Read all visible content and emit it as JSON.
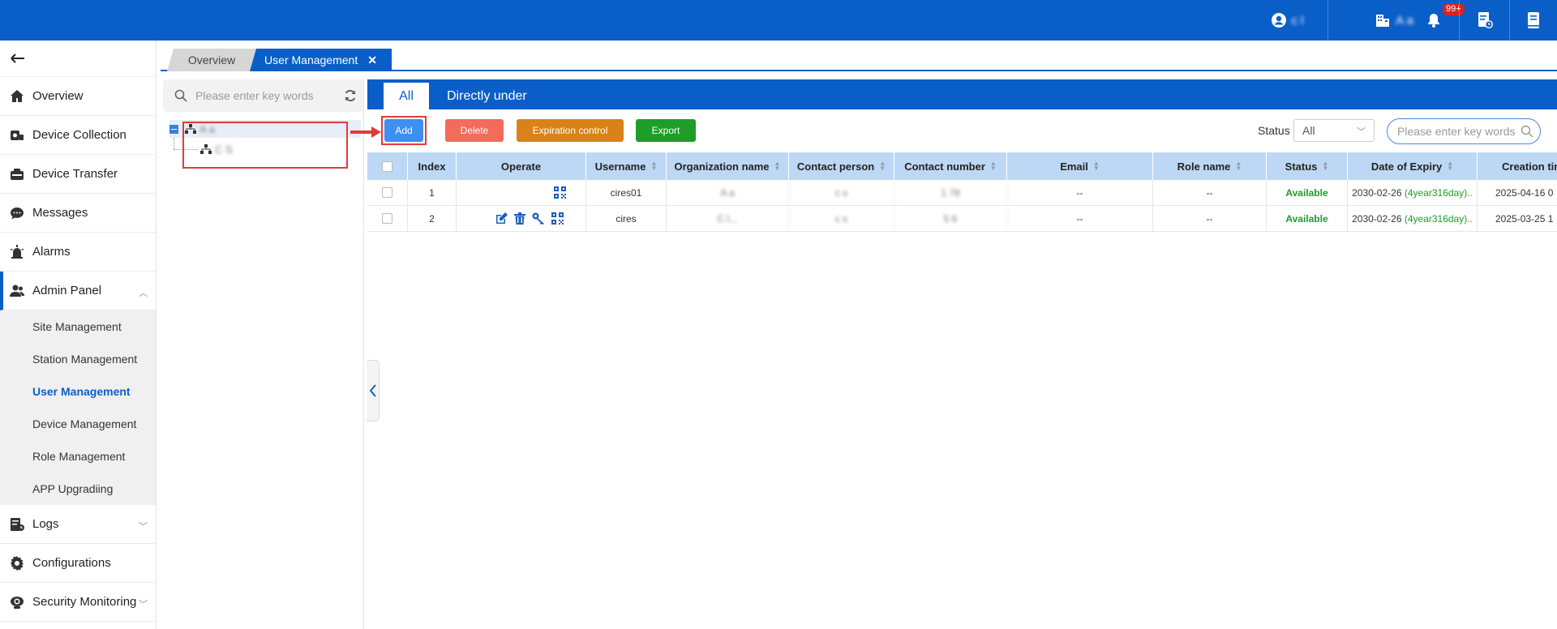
{
  "topbar": {
    "user_name": "c      l",
    "org_name": "A      a",
    "notification_badge": "99+"
  },
  "sidebar": {
    "items": [
      {
        "label": "Overview",
        "icon": "home-icon"
      },
      {
        "label": "Device Collection",
        "icon": "device-collection-icon"
      },
      {
        "label": "Device Transfer",
        "icon": "device-transfer-icon"
      },
      {
        "label": "Messages",
        "icon": "messages-icon"
      },
      {
        "label": "Alarms",
        "icon": "alarm-icon"
      },
      {
        "label": "Admin Panel",
        "icon": "admin-icon"
      }
    ],
    "submenu": [
      {
        "label": "Site Management"
      },
      {
        "label": "Station Management"
      },
      {
        "label": "User Management"
      },
      {
        "label": "Device Management"
      },
      {
        "label": "Role Management"
      },
      {
        "label": "APP Upgradiing"
      }
    ],
    "bottom_items": [
      {
        "label": "Logs",
        "icon": "logs-icon"
      },
      {
        "label": "Configurations",
        "icon": "gear-icon"
      },
      {
        "label": "Security Monitoring",
        "icon": "camera-icon"
      }
    ]
  },
  "tabs": {
    "overview": "Overview",
    "user_management": "User Management",
    "close": "✕"
  },
  "tree": {
    "search_placeholder": "Please enter key words",
    "root": "A      a",
    "child": "C         S"
  },
  "main": {
    "tab_all": "All",
    "tab_direct": "Directly under",
    "btn_add": "Add",
    "btn_delete": "Delete",
    "btn_expiration": "Expiration control",
    "btn_export": "Export",
    "status_label": "Status",
    "status_value": "All",
    "search_placeholder": "Please enter key words"
  },
  "table": {
    "headers": [
      "Index",
      "Operate",
      "Username",
      "Organization name",
      "Contact person",
      "Contact number",
      "Email",
      "Role name",
      "Status",
      "Date of Expiry",
      "Creation tim"
    ],
    "rows": [
      {
        "index": "1",
        "username": "cires01",
        "org": "A    a",
        "contact": "c   s",
        "number": "1         78",
        "email": "--",
        "role": "--",
        "status": "Available",
        "expiry": "2030-02-26",
        "expiry_rel": "(4year316day)..",
        "created": "2025-04-16 0"
      },
      {
        "index": "2",
        "username": "cires",
        "org": "C              l...",
        "contact": "c   s",
        "number": "5       6",
        "email": "--",
        "role": "--",
        "status": "Available",
        "expiry": "2030-02-26",
        "expiry_rel": "(4year316day)..",
        "created": "2025-03-25 1"
      }
    ]
  },
  "colors": {
    "brand": "#0a5ec8",
    "delete": "#f26b5b",
    "expiration": "#d98218",
    "export": "#1c9e28",
    "add": "#3d8ff0",
    "annotation": "#e23a3a"
  }
}
